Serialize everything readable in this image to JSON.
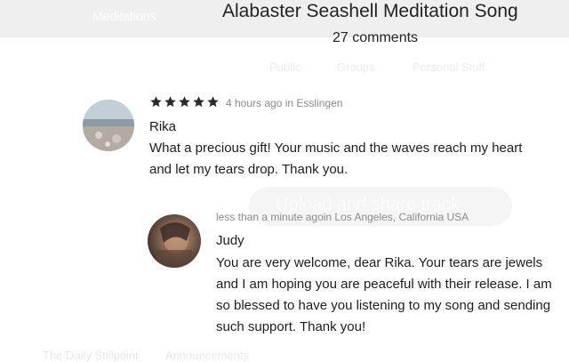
{
  "background": {
    "nav_label": "Meditations",
    "tabs": [
      "Public",
      "Groups",
      "Personal Stuff"
    ],
    "pill_label": "Upload and share track",
    "footer_links": [
      "The Daily Stillpoint",
      "Announcements"
    ]
  },
  "overlay": {
    "title": "Alabaster Seashell Meditation Song",
    "comment_count": "27 comments"
  },
  "comments": [
    {
      "author": "Rika",
      "meta": "4 hours ago in Esslingen",
      "rating": 5,
      "text": "What a precious gift! Your music and the waves reach my heart and let my tears drop. Thank you."
    },
    {
      "author": "Judy",
      "meta": "less than a minute agoin Los Angeles, California USA",
      "text": "You are very welcome, dear Rika. Your tears are jewels and I am hoping you are peaceful with their release. I am so blessed to have you listening to my song and sending such support. Thank you!"
    }
  ],
  "colors": {
    "text": "#1e1e1e",
    "meta": "#8a8a8a",
    "star": "#2b2b2b",
    "faded_header": "#efefef"
  }
}
